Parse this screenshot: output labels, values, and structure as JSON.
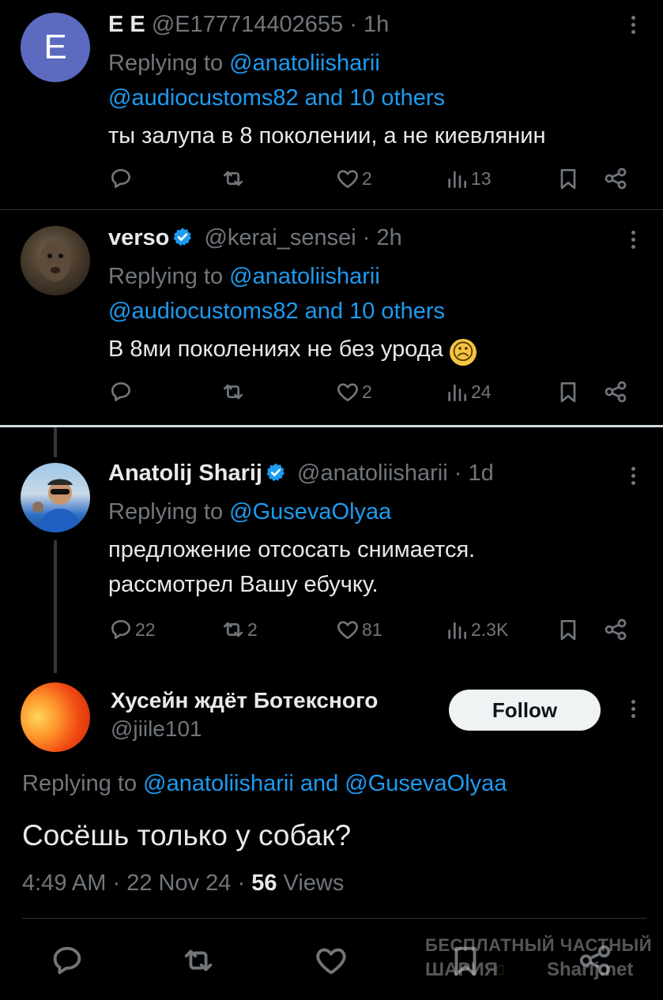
{
  "tweets": [
    {
      "avatar_letter": "E",
      "name": "E E",
      "handle": "@E177714402655",
      "time": "1h",
      "replying_prefix": "Replying to ",
      "replying_to": "@anatoliisharii",
      "replying_rest": "@audiocustoms82 and 10 others",
      "text": "ты залупа в 8 поколении, а не киевлянин",
      "replies": "",
      "retweets": "",
      "likes": "2",
      "views": "13"
    },
    {
      "name": "verso",
      "handle": "@kerai_sensei",
      "time": "2h",
      "replying_prefix": "Replying to ",
      "replying_to": "@anatoliisharii",
      "replying_rest": "@audiocustoms82 and 10 others",
      "text": "В 8ми поколениях не без урода",
      "emoji": "☹",
      "replies": "",
      "retweets": "",
      "likes": "2",
      "views": "24"
    },
    {
      "name": "Anatolij Sharij",
      "handle": "@anatoliisharii",
      "time": "1d",
      "replying_prefix": "Replying to ",
      "replying_to": "@GusevaOlyaa",
      "text_line1": "предложение отсосать снимается.",
      "text_line2": "рассмотрел Вашу ебучку.",
      "replies": "22",
      "retweets": "2",
      "likes": "81",
      "views": "2.3K"
    }
  ],
  "main_tweet": {
    "name": "Хусейн ждёт Ботексного",
    "handle": "@jiile101",
    "follow_label": "Follow",
    "replying_prefix": "Replying to ",
    "replying_to_1": "@anatoliisharii",
    "replying_and": " and ",
    "replying_to_2": "@GusevaOlyaa",
    "text": "Сосёшь только у собак?",
    "time": "4:49 AM",
    "date": "22 Nov 24",
    "views_count": "56",
    "views_label": "Views"
  },
  "watermark": {
    "line1": "БЕСПЛАТНЫЙ ЧАСТНЫЙ",
    "line2": "ШАРИЯ",
    "line3": "Sharij.net"
  },
  "separator_dot": "·",
  "colors": {
    "background": "#000000",
    "link": "#1d9bf0",
    "muted": "#71767b",
    "verified": "#1d9bf0",
    "avatar_e": "#5c6bc0"
  },
  "icons": [
    "reply-icon",
    "retweet-icon",
    "like-icon",
    "views-icon",
    "bookmark-icon",
    "share-icon",
    "more-icon",
    "verified-icon"
  ]
}
